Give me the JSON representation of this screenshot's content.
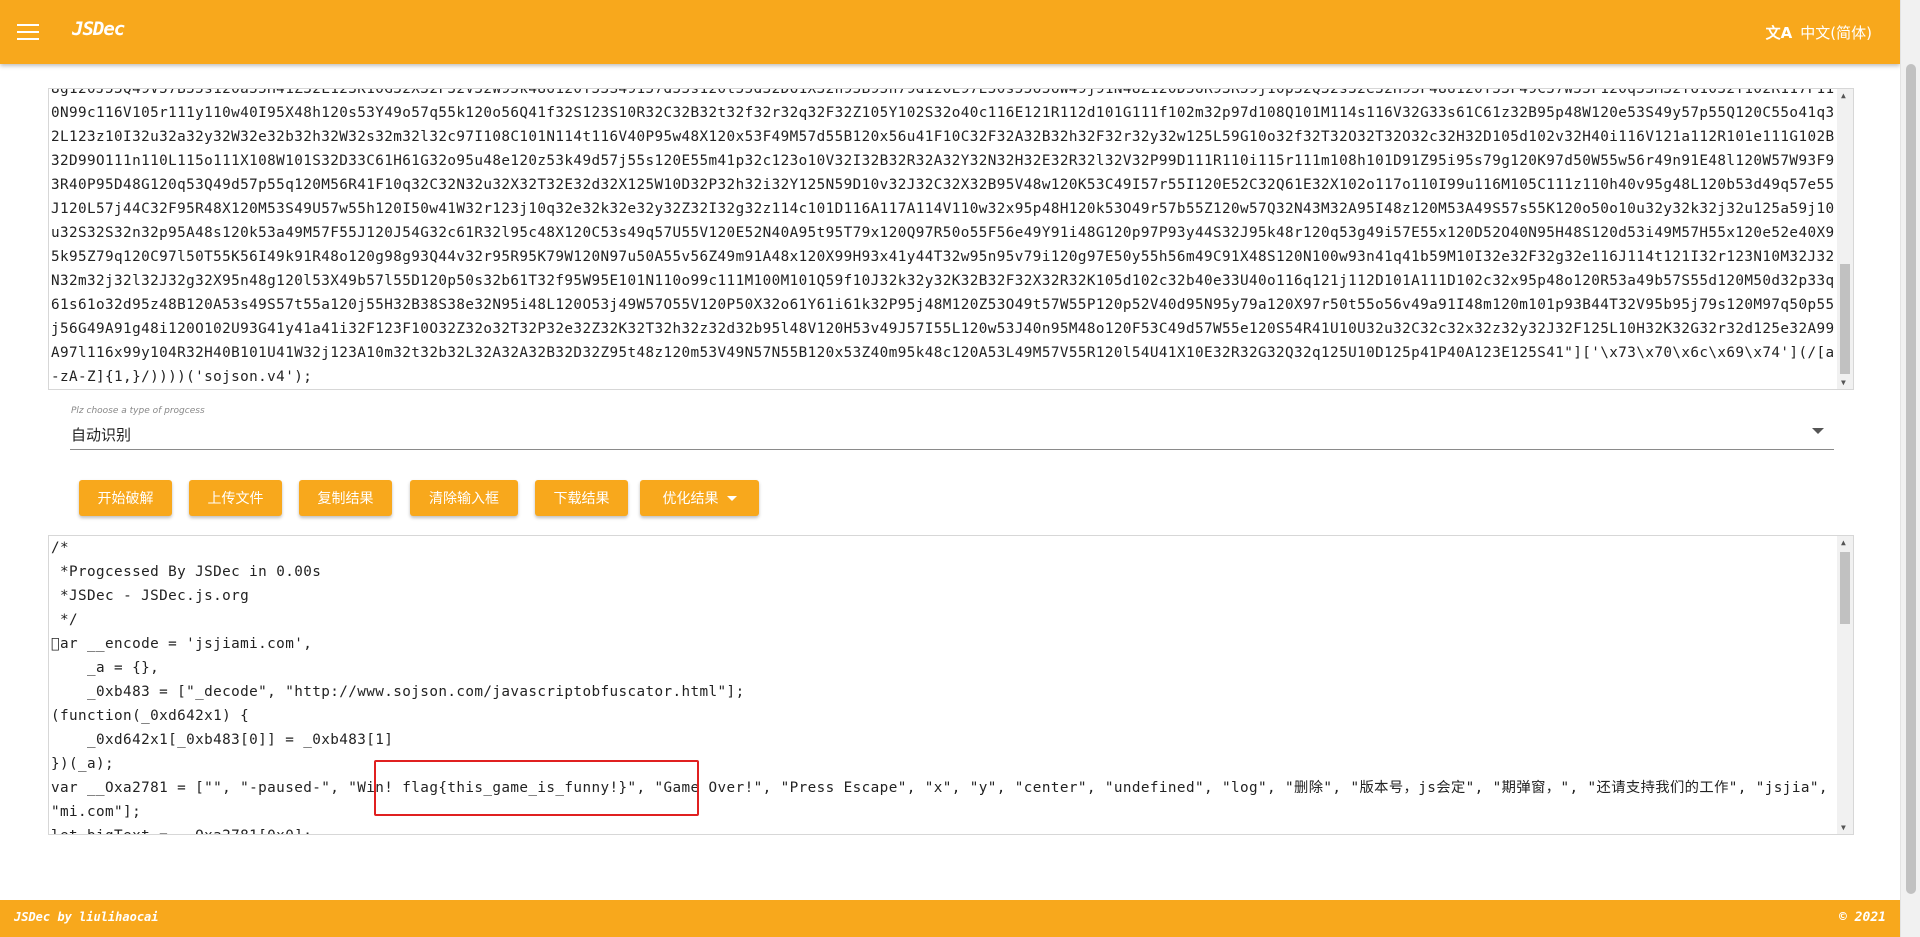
{
  "header": {
    "title": "JSDec",
    "language_label": "中文(简体)",
    "language_icon": "translate-icon",
    "menu_icon": "hamburger-menu-icon"
  },
  "input": {
    "code": "8g120J53Q49V57B55s120a55H41Z32L123K10G32X32F32V32W95k48o120T53S49157d55s120t55d32D61X32h95B95h79d120E97E50s55o56W49j91N48Z120D56R93R59j10p32Q32s32e32H95F48U120Y53F49C57W55F120q53M32T61032Y102R117F110N99c116V105r111y110w40I95X48h120s53Y49o57q55k120o56Q41f32S123S10R32C32B32t32f32r32q32F32Z105Y102S32o40c116E121R112d101G111f102m32p97d108Q101M114s116V32G33s61C61z32B95p48W120e53S49y57p55Q120C55o41q32L123z10I32u32a32y32W32e32b32h32W32s32m32l32c97I108C101N114t116V40P95w48X120x53F49M57d55B120x56u41F10C32F32A32B32h32F32r32y32w125L59G10o32f32T32O32T32O32c32H32D105d102v32H40i116V121a112R101e111G102B32D99O111n110L115o111X108W101S32D33C61H61G32o95u48e120z53k49d57j55s120E55m41p32c123o10V32I32B32R32A32Y32N32H32E32R32l32V32P99D111R110i115r111m108h101D91Z95i95s79g120K97d50W55w56r49n91E48l120W57W93F93R40P95D48G120q53Q49d57p55q120M56R41F10q32C32N32u32X32T32E32d32X125W10D32P32h32i32Y125N59D10v32J32C32X32B95V48w120K53C49I57r55I120E52C32Q61E32X102o117o110I99u116M105C111z110h40v95g48L120b53d49q57e55J120L57j44C32F95R48X120M53S49U57w55h120I50w41W32r123j10q32e32k32e32y32Z32I32g32z114c101D116A117A114V110w32x95p48H120k53O49r57b55Z120w57Q32N43M32A95I48z120M53A49S57s55K120o50o10u32y32k32j32u125a59j10u32S32S32n32p95A48s120k53a49M57F55J120J54G32c61R32l95c48X120C53s49q57U55V120E52N40A95t95T79x120Q97R50o55F56e49Y91i48G120p97P93y44S32J95k48r120q53g49i57E55x120D52O40N95H48S120d53i49M57H55x120e52e40X95k95Z79q120C97l50T55K56I49k91R48o120g98g93Q44v32r95R95K79W120N97u50A55v56Z49m91A48x120X99H93x41y44T32w95n95v79i120g97E50y55h56m49C91X48S120N100w93n41q41b59M10I32e32F32g32e116J114t121I32r123N10M32J32N32m32j32l32J32g32X95n48g120l53X49b57l55D120p50s32b61T32f95W95E101N110o99c111M100M101Q59f10J32k32y32K32B32F32X32R32K105d102c32b40e33U40o116q121j112D101A111D102c32x95p48o120R53a49b57S55d120M50d32p33q61s61o32d95z48B120A53s49S57t55a120j55H32B38S38e32N95i48L120O53j49W57O55V120P50X32o61Y61i61k32P95j48M120Z53O49t57W55P120p52V40d95N95y79a120X97r50t55o56v49a91I48m120m101p93B44T32V95b95j79s120M97q50p55j56G49A91g48i120O102U93G41y41a41i32F123F10O32Z32o32T32P32e32Z32K32T32h32z32d32b95l48V120H53v49J57I55L120w53J40n95M48o120F53C49d57W55e120S54R41U10U32u32C32c32x32z32y32J32F125L10H32K32G32r32d125e32A99A97l116x99y104R32H40B101U41W32j123A10m32t32b32L32A32A32B32D32Z95t48z120m53V49N57N55B120x53Z40m95k48c120A53L49M57V55R120l54U41X10E32R32G32Q32q125U10D125p41P40A123E125S41\"]['\\x73\\x70\\x6c\\x69\\x74'](/[a-zA-Z]{1,}/))))('sojson.v4');"
  },
  "process_select": {
    "label": "Plz choose a type of progcess",
    "value": "自动识别"
  },
  "buttons": {
    "start": "开始破解",
    "upload": "上传文件",
    "copy": "复制结果",
    "clear": "清除输入框",
    "download": "下载结果",
    "optimize": "优化结果"
  },
  "output": {
    "code": "/*\n *Progcessed By JSDec in 0.00s\n *JSDec - JSDec.js.org\n */\n\u0000ar __encode = 'jsjiami.com',\n    _a = {},\n    _0xb483 = [\"_decode\", \"http://www.sojson.com/javascriptobfuscator.html\"];\n(function(_0xd642x1) {\n    _0xd642x1[_0xb483[0]] = _0xb483[1]\n})(_a);\nvar __Oxa2781 = [\"\", \"-paused-\", \"Win! flag{this_game_is_funny!}\", \"Game Over!\", \"Press Escape\", \"x\", \"y\", \"center\", \"undefined\", \"log\", \"删除\", \"版本号，js会定\", \"期弹窗，\", \"还请支持我们的工作\", \"jsjia\", \"mi.com\"];\nlet bigText = __Oxa2781[0x0];"
  },
  "footer": {
    "credit": "JSDec by liulihaocai",
    "year": "© 2021"
  },
  "colors": {
    "accent": "#f8a81c",
    "highlight": "#e02020"
  }
}
